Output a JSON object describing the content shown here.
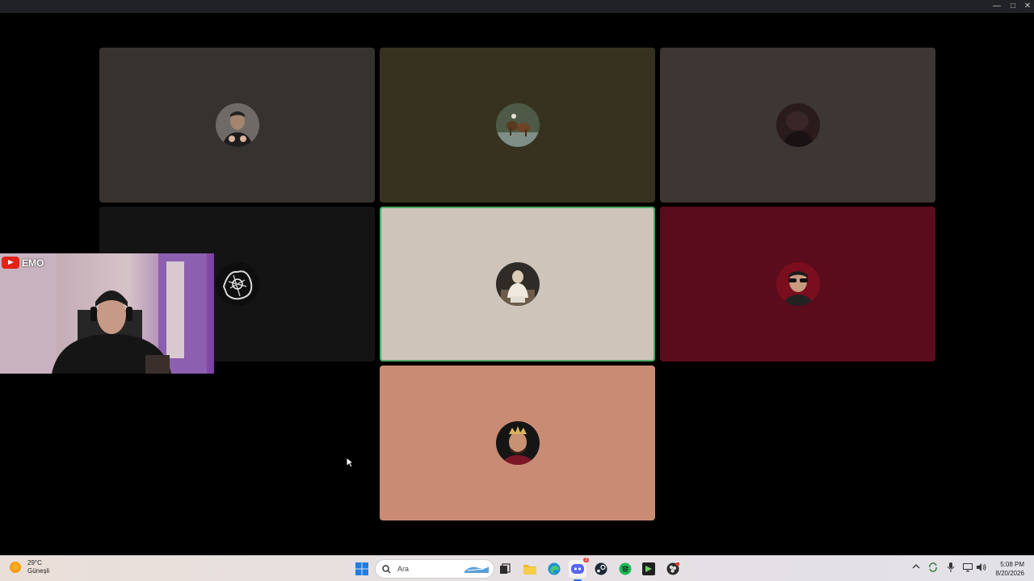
{
  "window": {
    "controls": [
      "minimize",
      "maximize",
      "close"
    ]
  },
  "grid": {
    "tiles": [
      {
        "bg": "#36332e",
        "avatar": "man-selfie",
        "speaking": false
      },
      {
        "bg": "#37321f",
        "avatar": "horses",
        "speaking": false
      },
      {
        "bg": "#3d3633",
        "avatar": "dark-silhouette",
        "speaking": false
      },
      {
        "bg": "#141414",
        "avatar": "sketch-art",
        "speaking": false
      },
      {
        "bg": "#cfc4b9",
        "avatar": "white-hoodie",
        "speaking": true
      },
      {
        "bg": "#5a0b1c",
        "avatar": "sunglasses-man",
        "speaking": false
      },
      {
        "bg": "#c98b73",
        "avatar": "crown-man",
        "speaking": false
      }
    ]
  },
  "webcam": {
    "channel_name": "EMO",
    "badge_icon": "youtube-icon"
  },
  "taskbar": {
    "weather": {
      "temp": "29°C",
      "condition": "Güneşli"
    },
    "search_placeholder": "Ara",
    "apps": [
      "windows-start-icon",
      "task-view-icon",
      "file-explorer-icon",
      "edge-icon",
      "discord-icon",
      "steam-icon",
      "spotify-icon",
      "terminal-icon",
      "obs-icon"
    ],
    "discord_badge": "3",
    "clock": {
      "time": "5:08 PM",
      "date": "8/20/2026"
    },
    "tray": [
      "chevron-up-icon",
      "sync-icon",
      "mic-icon",
      "display-icon",
      "volume-icon"
    ]
  }
}
